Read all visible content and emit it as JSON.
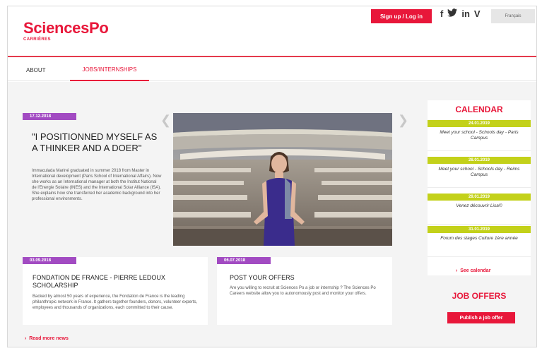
{
  "brand": {
    "logo_main": "SciencesPo",
    "logo_sub": "CARRIÈRES",
    "color": "#e8173a"
  },
  "header": {
    "signup_label": "Sign up / Log in",
    "social": [
      {
        "icon": "facebook-icon",
        "glyph": "f"
      },
      {
        "icon": "twitter-icon",
        "glyph": "🐦"
      },
      {
        "icon": "linkedin-icon",
        "glyph": "in"
      },
      {
        "icon": "vimeo-icon",
        "glyph": "V"
      }
    ],
    "language_label": "Français"
  },
  "nav": {
    "about": "ABOUT",
    "jobs": "JOBS/INTERNSHIPS"
  },
  "featured": {
    "date": "17.12.2018",
    "title": "\"I POSITIONNED MYSELF AS A THINKER AND A DOER\"",
    "body": "Immaculada Mariné graduated in summer 2018 from Master in International development (Paris School of International Affairs). Now she works as an International manager at both the Institut National de l'Energie Solaire (INES) and the International Solar Alliance (ISA). She explains how she transferred her academic background into her professional environments."
  },
  "news": [
    {
      "date": "03.09.2018",
      "title": "FONDATION DE FRANCE - PIERRE LEDOUX SCHOLARSHIP",
      "body": "Backed by almost 50 years of experience, the Fondation de France is the leading philanthropic network in France. It gathers together founders, donors, volunteer experts, employees and thousands of organizations, each committed to their cause."
    },
    {
      "date": "06.07.2018",
      "title": "POST YOUR OFFERS",
      "body": "Are you willing to recruit at Sciences Po a job or internship ? The Sciences Po Careers website allow you to autonomously post and monitor your offers."
    }
  ],
  "read_more": "Read more news",
  "calendar": {
    "title": "CALENDAR",
    "events": [
      {
        "date": "24.01.2019",
        "text": "Meet your school - Schools day - Paris Campus"
      },
      {
        "date": "28.01.2019",
        "text": "Meet your school - Schools day - Reims Campus"
      },
      {
        "date": "29.01.2019",
        "text": "Venez découvrir Lisa©"
      },
      {
        "date": "31.01.2019",
        "text": "Forum des stages Culture 1ère année"
      }
    ],
    "see_all": "See calendar"
  },
  "job_offers": {
    "title": "JOB OFFERS",
    "button": "Publish a job offer"
  }
}
